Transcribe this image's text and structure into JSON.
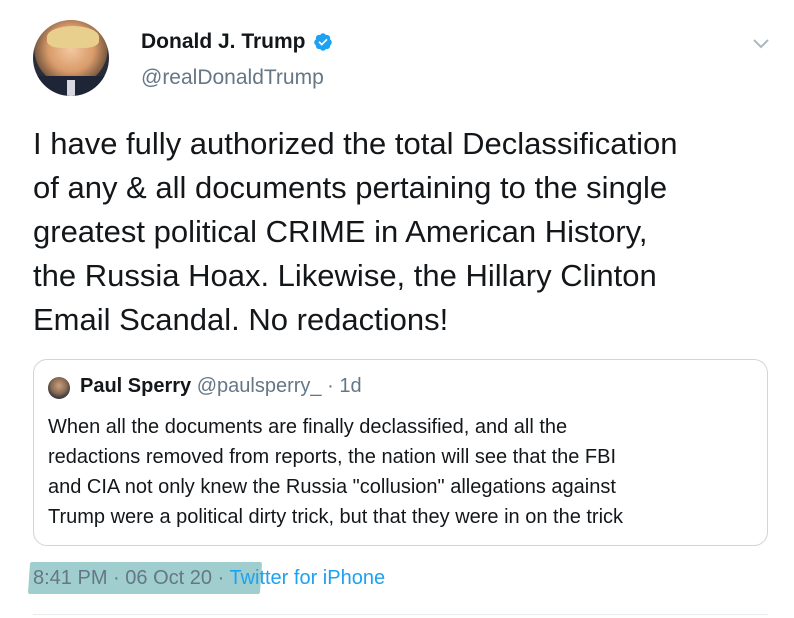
{
  "tweet": {
    "author_name": "Donald J. Trump",
    "author_handle": "@realDonaldTrump",
    "verified_icon": "verified-badge-icon",
    "menu_icon": "chevron-down-icon",
    "text": "I have fully authorized the total Declassification\nof any & all documents pertaining to the single\ngreatest political CRIME in American History,\nthe Russia Hoax. Likewise, the Hillary Clinton\nEmail Scandal. No redactions!",
    "time": "8:41 PM",
    "date": "06 Oct 20",
    "dot": "·",
    "source": "Twitter for iPhone"
  },
  "quoted_tweet": {
    "author_name": "Paul Sperry",
    "author_handle": "@paulsperry_",
    "dot": "·",
    "age": "1d",
    "text": "When all the documents are finally declassified, and all the\nredactions removed from reports, the nation will see that the FBI\nand CIA not only knew the Russia \"collusion\" allegations against\nTrump were a political dirty trick, but that they were in on the trick"
  },
  "colors": {
    "text_primary": "#14171a",
    "text_secondary": "#657786",
    "link_blue": "#1da1f2",
    "highlight": "#8fc6c6",
    "border": "#ccd6dd"
  }
}
